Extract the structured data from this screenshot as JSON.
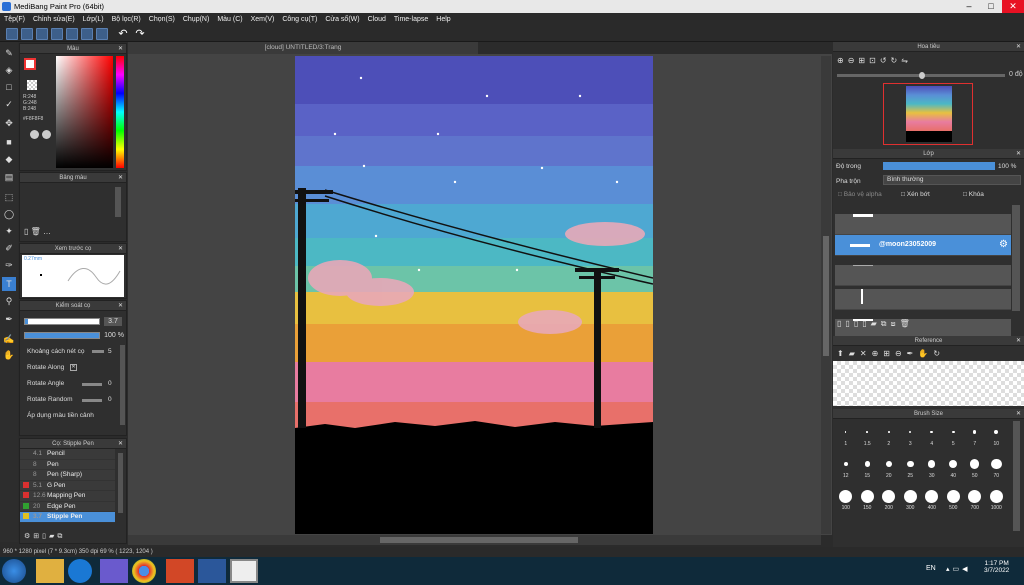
{
  "window": {
    "title": "MediBang Paint Pro (64bit)"
  },
  "menu": [
    "Tệp(F)",
    "Chỉnh sửa(E)",
    "Lớp(L)",
    "Bộ lọc(R)",
    "Chọn(S)",
    "Chụp(N)",
    "Màu (C)",
    "Xem(V)",
    "Công cụ(T)",
    "Cửa sổ(W)",
    "Cloud",
    "Time-lapse",
    "Help"
  ],
  "canvas": {
    "tab": "[cloud] UNTITLED/3:Trang"
  },
  "color_panel": {
    "title": "Màu",
    "r": "R:248",
    "g": "G:248",
    "b": "B:248",
    "hex": "#F8F8F8"
  },
  "palette_panel": {
    "title": "Bảng màu"
  },
  "preview_panel": {
    "title": "Xem trước cọ",
    "size": "0.27mm"
  },
  "brush_control": {
    "title": "Kiểm soát cọ",
    "size_value": "3.7",
    "opacity_value": "100 %",
    "spacing_label": "Khoảng cách nét cọ",
    "spacing_value": "5",
    "rotate_along": "Rotate Along",
    "rotate_angle": "Rotate Angle",
    "rotate_angle_value": "0",
    "rotate_random": "Rotate Random",
    "rotate_random_value": "0",
    "apply_fg": "Áp dụng màu tiền cảnh"
  },
  "brush_list": {
    "title": "Cọ: Stipple Pen",
    "items": [
      {
        "size": "4.1",
        "name": "Pencil",
        "color": "#3a3a3a"
      },
      {
        "size": "8",
        "name": "Pen",
        "color": "#3a3a3a"
      },
      {
        "size": "8",
        "name": "Pen (Sharp)",
        "color": "#3a3a3a"
      },
      {
        "size": "5.1",
        "name": "G Pen",
        "color": "#d93030"
      },
      {
        "size": "12.6",
        "name": "Mapping Pen",
        "color": "#d93030"
      },
      {
        "size": "20",
        "name": "Edge Pen",
        "color": "#30a030"
      },
      {
        "size": "3.7",
        "name": "Stipple Pen",
        "color": "#e0c020"
      }
    ]
  },
  "navigator": {
    "title": "Hoa tiêu",
    "angle": "0 độ"
  },
  "layer_panel": {
    "title": "Lớp",
    "opacity_label": "Độ trong",
    "opacity_value": "100 %",
    "blend_label": "Pha trộn",
    "blend_value": "Bình thường",
    "protect_alpha": "Bảo vệ alpha",
    "clipping": "Xén bớt",
    "lock": "Khóa",
    "selected_layer": "@moon23052009"
  },
  "reference_panel": {
    "title": "Reference"
  },
  "brush_size_panel": {
    "title": "Brush Size",
    "sizes": [
      "1",
      "1.5",
      "2",
      "3",
      "4",
      "5",
      "7",
      "10",
      "12",
      "15",
      "20",
      "25",
      "30",
      "40",
      "50",
      "70",
      "100",
      "150",
      "200",
      "300",
      "400",
      "500",
      "700",
      "1000"
    ]
  },
  "status": {
    "text": "960 * 1280 pixel  (7 * 9.3cm)  350 dpi  69 %  ( 1223, 1204 )"
  },
  "taskbar": {
    "lang": "EN",
    "time": "1:17 PM",
    "date": "3/7/2022"
  }
}
